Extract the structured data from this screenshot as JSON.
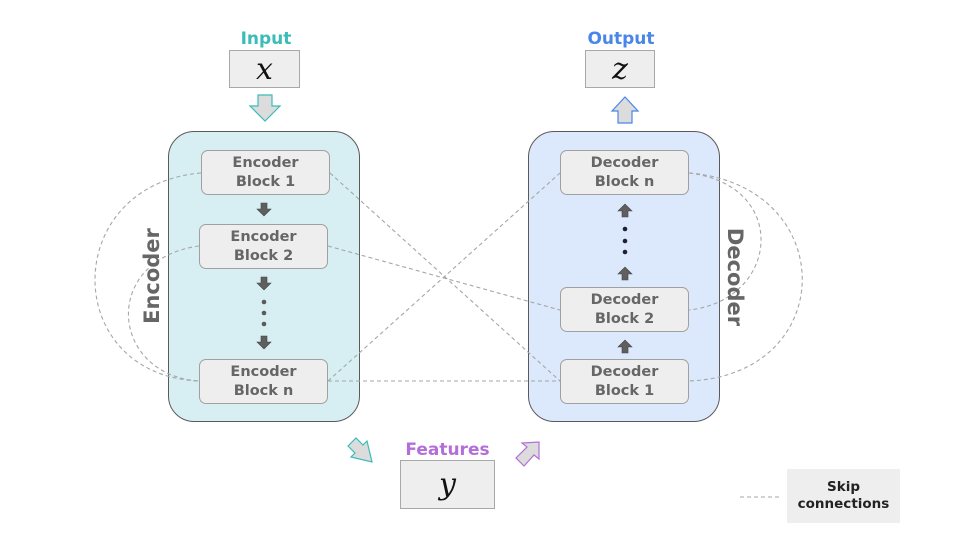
{
  "input": {
    "label": "Input",
    "variable": "x",
    "color": "#3bbcb8"
  },
  "output": {
    "label": "Output",
    "variable": "z",
    "color": "#4a86e8"
  },
  "features": {
    "label": "Features",
    "variable": "y",
    "color": "#b36ed8"
  },
  "encoder": {
    "label": "Encoder",
    "fill": "#d7eff2",
    "blocks": [
      {
        "line1": "Encoder",
        "line2": "Block 1"
      },
      {
        "line1": "Encoder",
        "line2": "Block 2"
      },
      {
        "line1": "Encoder",
        "line2": "Block n"
      }
    ]
  },
  "decoder": {
    "label": "Decoder",
    "fill": "#dce8fb",
    "blocks": [
      {
        "line1": "Decoder",
        "line2": "Block n"
      },
      {
        "line1": "Decoder",
        "line2": "Block 2"
      },
      {
        "line1": "Decoder",
        "line2": "Block 1"
      }
    ]
  },
  "legend": {
    "line1": "Skip",
    "line2": "connections",
    "line_style": "dashed"
  }
}
